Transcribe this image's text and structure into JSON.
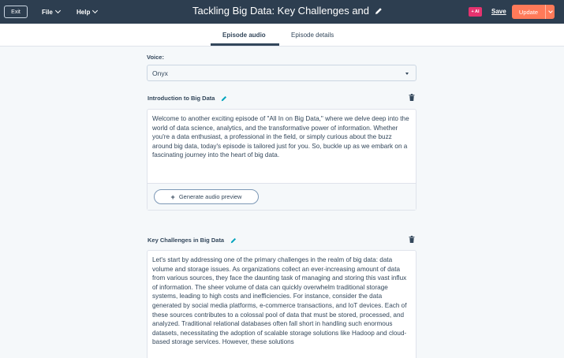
{
  "topbar": {
    "exit_label": "Exit",
    "file_label": "File",
    "help_label": "Help",
    "title": "Tackling Big Data: Key Challenges and",
    "ai_badge": "+ AI",
    "save_label": "Save",
    "update_label": "Update"
  },
  "tabs": [
    {
      "label": "Episode audio",
      "active": true
    },
    {
      "label": "Episode details",
      "active": false
    }
  ],
  "voice": {
    "label": "Voice:",
    "selected": "Onyx"
  },
  "sections": [
    {
      "title": "Introduction to Big Data",
      "text": "Welcome to another exciting episode of \"All In on Big Data,\" where we delve deep into the world of data science, analytics, and the transformative power of information. Whether you're a data enthusiast, a professional in the field, or simply curious about the buzz around big data, today's episode is tailored just for you. So, buckle up as we embark on a fascinating journey into the heart of big data.",
      "button_label": "Generate audio preview"
    },
    {
      "title": "Key Challenges in Big Data",
      "text": "Let's start by addressing one of the primary challenges in the realm of big data: data volume and storage issues. As organizations collect an ever-increasing amount of data from various sources, they face the daunting task of managing and storing this vast influx of information. The sheer volume of data can quickly overwhelm traditional storage systems, leading to high costs and inefficiencies. For instance, consider the data generated by social media platforms, e-commerce transactions, and IoT devices. Each of these sources contributes to a colossal pool of data that must be stored, processed, and analyzed. Traditional relational databases often fall short in handling such enormous datasets, necessitating the adoption of scalable storage solutions like Hadoop and cloud-based storage services. However, these solutions"
    }
  ],
  "colors": {
    "topbar_bg": "#2d3e50",
    "accent_orange": "#ff7a59",
    "ai_pink": "#e5336f",
    "edit_teal": "#00a4bd"
  }
}
